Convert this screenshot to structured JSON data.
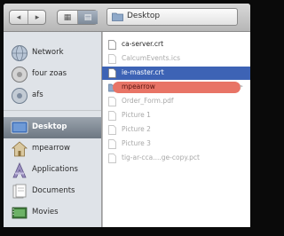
{
  "toolbar": {
    "back_glyph": "◂",
    "forward_glyph": "▸",
    "icon_view_glyph": "▦",
    "list_view_glyph": "▤",
    "location": "Desktop"
  },
  "sidebar": {
    "devices": [
      {
        "label": "Network",
        "icon": "network-globe-icon"
      },
      {
        "label": "four zoas",
        "icon": "hard-drive-icon"
      },
      {
        "label": "afs",
        "icon": "network-drive-icon"
      }
    ],
    "places": [
      {
        "label": "Desktop",
        "icon": "desktop-icon",
        "selected": true
      },
      {
        "label": "mpearrow",
        "icon": "home-icon"
      },
      {
        "label": "Applications",
        "icon": "applications-icon"
      },
      {
        "label": "Documents",
        "icon": "documents-icon"
      },
      {
        "label": "Movies",
        "icon": "movies-icon"
      }
    ]
  },
  "files": [
    {
      "name": "ca-server.crt",
      "state": "normal"
    },
    {
      "name": "CalcumEvents.ics",
      "state": "dim"
    },
    {
      "name": "ie-master.crt",
      "state": "selected"
    },
    {
      "name": "mpearrow",
      "state": "labeled",
      "label_color": "#e87466"
    },
    {
      "name": "Order_Form.pdf",
      "state": "dim"
    },
    {
      "name": "Picture 1",
      "state": "dim"
    },
    {
      "name": "Picture 2",
      "state": "dim"
    },
    {
      "name": "Picture 3",
      "state": "dim"
    },
    {
      "name": "tig-ar-cca....ge-copy.pct",
      "state": "dim"
    }
  ],
  "colors": {
    "selection": "#3d63b5",
    "label_red": "#e87466",
    "sidebar_bg": "#dfe3e8"
  }
}
